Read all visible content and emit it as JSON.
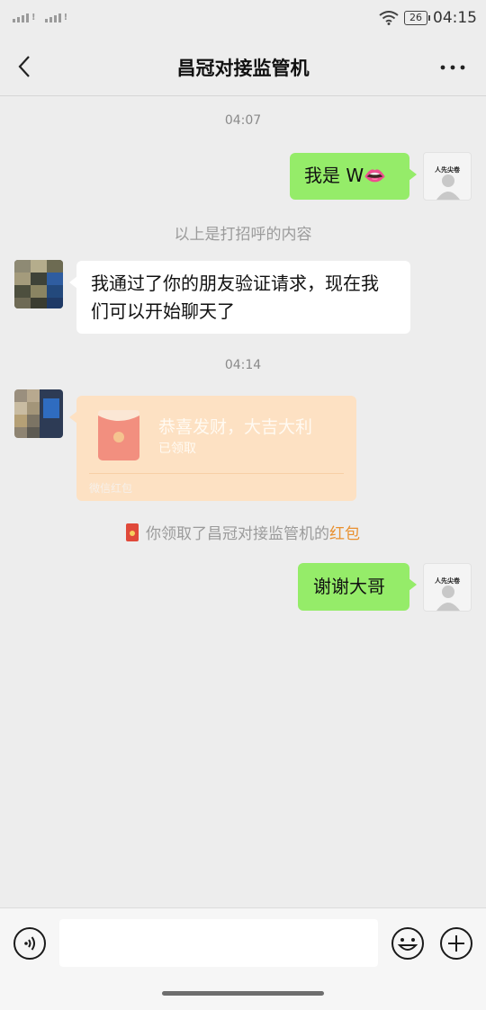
{
  "status_bar": {
    "battery_level": "26",
    "time": "04:15"
  },
  "header": {
    "title": "昌冠对接监管机"
  },
  "messages": {
    "time_1": "04:07",
    "msg_1": "我是 W👄",
    "self_avatar_tag": "人先尖卷",
    "greeting_note": "以上是打招呼的内容",
    "msg_2": "我通过了你的朋友验证请求，现在我们可以开始聊天了",
    "time_2": "04:14",
    "red_packet": {
      "title": "恭喜发财，大吉大利",
      "status": "已领取",
      "footer": "微信红包"
    },
    "notice": {
      "prefix": "你领取了昌冠对接监管机的",
      "link": "红包"
    },
    "msg_3": "谢谢大哥"
  },
  "input": {
    "value": "",
    "placeholder": ""
  },
  "colors": {
    "accent_green": "#95ec69",
    "red_packet": "#fde1c3",
    "link_orange": "#e9902f"
  },
  "icons": [
    "back-arrow-icon",
    "more-dots-icon",
    "voice-icon",
    "emoji-icon",
    "plus-icon",
    "wifi-icon",
    "battery-icon"
  ]
}
